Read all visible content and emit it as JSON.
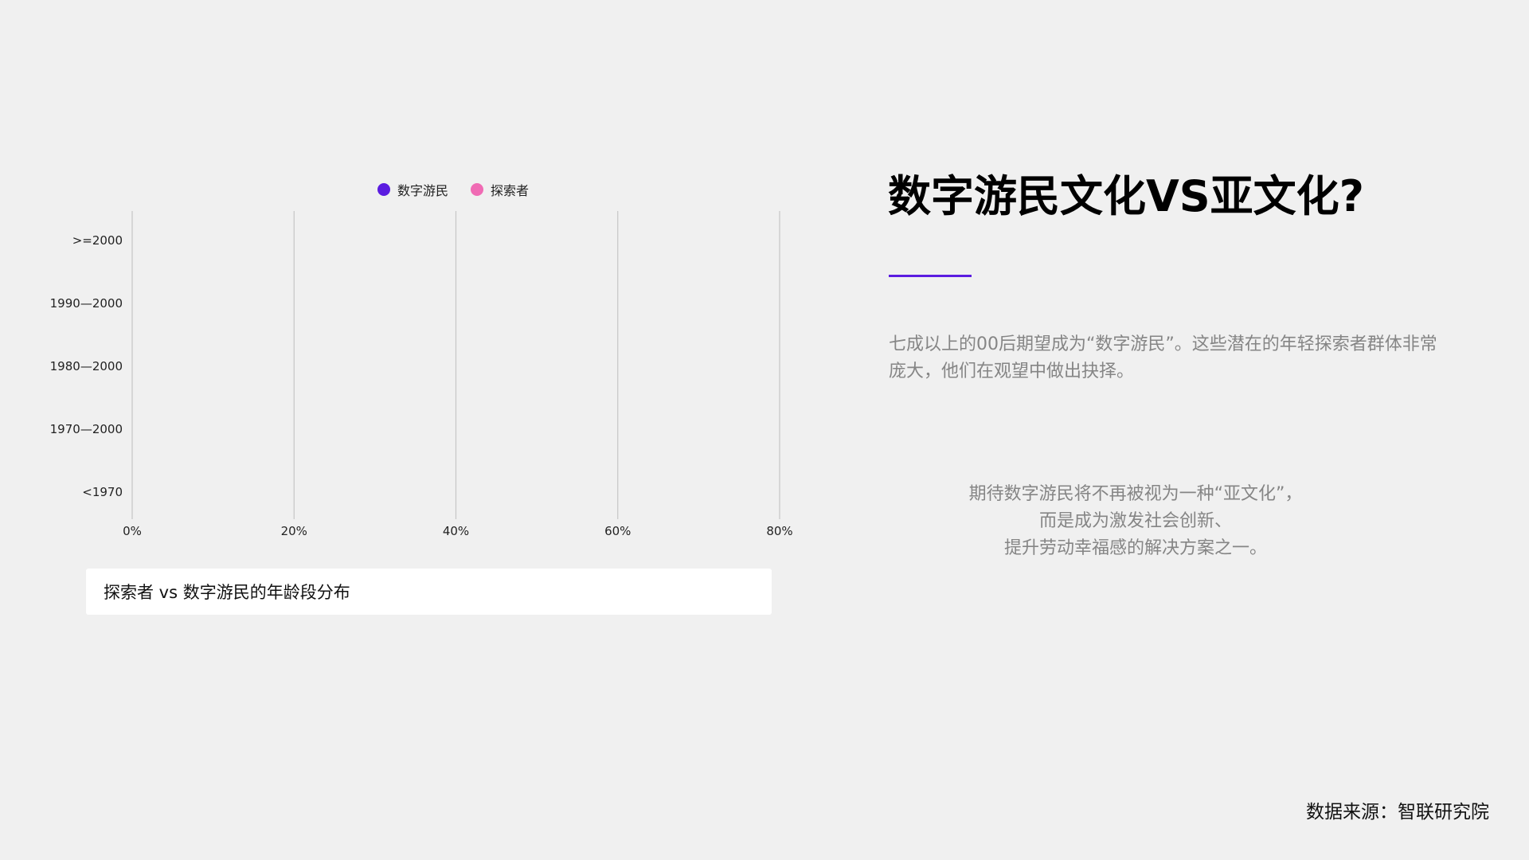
{
  "chart_data": {
    "type": "bar",
    "orientation": "horizontal",
    "categories": [
      ">=2000",
      "1990—2000",
      "1980—2000",
      "1970—2000",
      "<1970"
    ],
    "series": [
      {
        "name": "数字游民",
        "color": "#5b1ce0",
        "values": [
          0,
          0,
          0,
          0,
          0
        ]
      },
      {
        "name": "探索者",
        "color": "#f06bb4",
        "values": [
          0,
          0,
          0,
          0,
          0
        ]
      }
    ],
    "x_ticks": [
      "0%",
      "20%",
      "40%",
      "60%",
      "80%"
    ],
    "xlim": [
      0,
      80
    ],
    "grid": "vertical",
    "legend_position": "top"
  },
  "caption": "探索者 vs 数字游民的年龄段分布",
  "title": "数字游民文化VS亚文化?",
  "accent_color": "#5b1ce0",
  "description": "七成以上的00后期望成为“数字游民”。这些潜在的年轻探索者群体非常庞大，他们在观望中做出抉择。",
  "quote_lines": [
    "期待数字游民将不再被视为一种“亚文化”，",
    "而是成为激发社会创新、",
    "提升劳动幸福感的解决方案之一。"
  ],
  "source": "数据来源：智联研究院"
}
